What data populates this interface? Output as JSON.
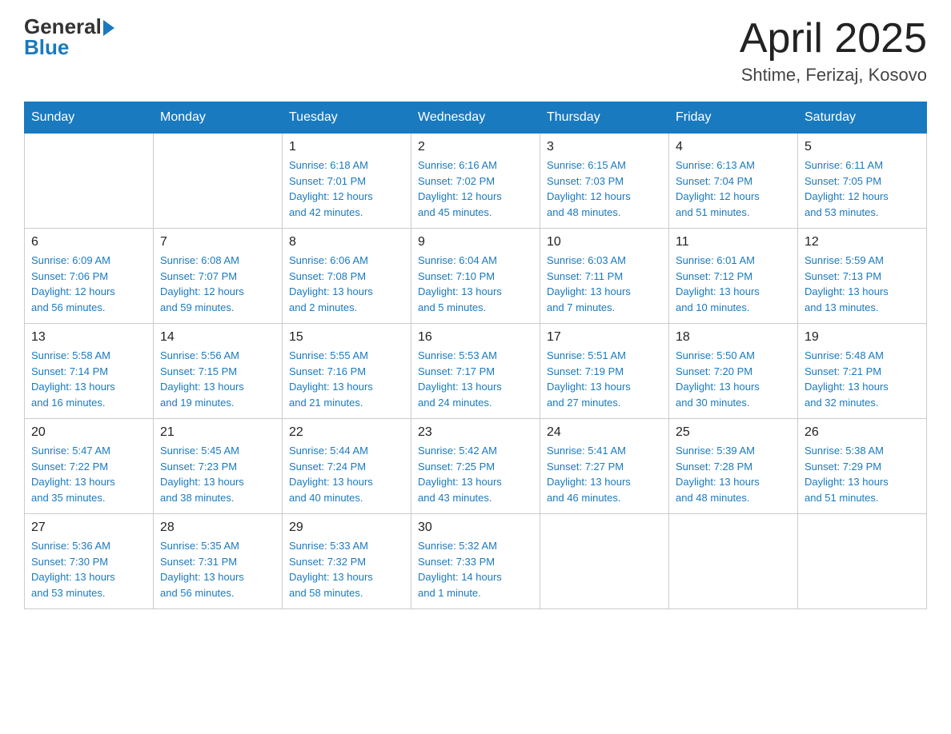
{
  "header": {
    "logo_general": "General",
    "logo_blue": "Blue",
    "title": "April 2025",
    "subtitle": "Shtime, Ferizaj, Kosovo"
  },
  "days_of_week": [
    "Sunday",
    "Monday",
    "Tuesday",
    "Wednesday",
    "Thursday",
    "Friday",
    "Saturday"
  ],
  "weeks": [
    [
      {
        "day": "",
        "info": ""
      },
      {
        "day": "",
        "info": ""
      },
      {
        "day": "1",
        "info": "Sunrise: 6:18 AM\nSunset: 7:01 PM\nDaylight: 12 hours\nand 42 minutes."
      },
      {
        "day": "2",
        "info": "Sunrise: 6:16 AM\nSunset: 7:02 PM\nDaylight: 12 hours\nand 45 minutes."
      },
      {
        "day": "3",
        "info": "Sunrise: 6:15 AM\nSunset: 7:03 PM\nDaylight: 12 hours\nand 48 minutes."
      },
      {
        "day": "4",
        "info": "Sunrise: 6:13 AM\nSunset: 7:04 PM\nDaylight: 12 hours\nand 51 minutes."
      },
      {
        "day": "5",
        "info": "Sunrise: 6:11 AM\nSunset: 7:05 PM\nDaylight: 12 hours\nand 53 minutes."
      }
    ],
    [
      {
        "day": "6",
        "info": "Sunrise: 6:09 AM\nSunset: 7:06 PM\nDaylight: 12 hours\nand 56 minutes."
      },
      {
        "day": "7",
        "info": "Sunrise: 6:08 AM\nSunset: 7:07 PM\nDaylight: 12 hours\nand 59 minutes."
      },
      {
        "day": "8",
        "info": "Sunrise: 6:06 AM\nSunset: 7:08 PM\nDaylight: 13 hours\nand 2 minutes."
      },
      {
        "day": "9",
        "info": "Sunrise: 6:04 AM\nSunset: 7:10 PM\nDaylight: 13 hours\nand 5 minutes."
      },
      {
        "day": "10",
        "info": "Sunrise: 6:03 AM\nSunset: 7:11 PM\nDaylight: 13 hours\nand 7 minutes."
      },
      {
        "day": "11",
        "info": "Sunrise: 6:01 AM\nSunset: 7:12 PM\nDaylight: 13 hours\nand 10 minutes."
      },
      {
        "day": "12",
        "info": "Sunrise: 5:59 AM\nSunset: 7:13 PM\nDaylight: 13 hours\nand 13 minutes."
      }
    ],
    [
      {
        "day": "13",
        "info": "Sunrise: 5:58 AM\nSunset: 7:14 PM\nDaylight: 13 hours\nand 16 minutes."
      },
      {
        "day": "14",
        "info": "Sunrise: 5:56 AM\nSunset: 7:15 PM\nDaylight: 13 hours\nand 19 minutes."
      },
      {
        "day": "15",
        "info": "Sunrise: 5:55 AM\nSunset: 7:16 PM\nDaylight: 13 hours\nand 21 minutes."
      },
      {
        "day": "16",
        "info": "Sunrise: 5:53 AM\nSunset: 7:17 PM\nDaylight: 13 hours\nand 24 minutes."
      },
      {
        "day": "17",
        "info": "Sunrise: 5:51 AM\nSunset: 7:19 PM\nDaylight: 13 hours\nand 27 minutes."
      },
      {
        "day": "18",
        "info": "Sunrise: 5:50 AM\nSunset: 7:20 PM\nDaylight: 13 hours\nand 30 minutes."
      },
      {
        "day": "19",
        "info": "Sunrise: 5:48 AM\nSunset: 7:21 PM\nDaylight: 13 hours\nand 32 minutes."
      }
    ],
    [
      {
        "day": "20",
        "info": "Sunrise: 5:47 AM\nSunset: 7:22 PM\nDaylight: 13 hours\nand 35 minutes."
      },
      {
        "day": "21",
        "info": "Sunrise: 5:45 AM\nSunset: 7:23 PM\nDaylight: 13 hours\nand 38 minutes."
      },
      {
        "day": "22",
        "info": "Sunrise: 5:44 AM\nSunset: 7:24 PM\nDaylight: 13 hours\nand 40 minutes."
      },
      {
        "day": "23",
        "info": "Sunrise: 5:42 AM\nSunset: 7:25 PM\nDaylight: 13 hours\nand 43 minutes."
      },
      {
        "day": "24",
        "info": "Sunrise: 5:41 AM\nSunset: 7:27 PM\nDaylight: 13 hours\nand 46 minutes."
      },
      {
        "day": "25",
        "info": "Sunrise: 5:39 AM\nSunset: 7:28 PM\nDaylight: 13 hours\nand 48 minutes."
      },
      {
        "day": "26",
        "info": "Sunrise: 5:38 AM\nSunset: 7:29 PM\nDaylight: 13 hours\nand 51 minutes."
      }
    ],
    [
      {
        "day": "27",
        "info": "Sunrise: 5:36 AM\nSunset: 7:30 PM\nDaylight: 13 hours\nand 53 minutes."
      },
      {
        "day": "28",
        "info": "Sunrise: 5:35 AM\nSunset: 7:31 PM\nDaylight: 13 hours\nand 56 minutes."
      },
      {
        "day": "29",
        "info": "Sunrise: 5:33 AM\nSunset: 7:32 PM\nDaylight: 13 hours\nand 58 minutes."
      },
      {
        "day": "30",
        "info": "Sunrise: 5:32 AM\nSunset: 7:33 PM\nDaylight: 14 hours\nand 1 minute."
      },
      {
        "day": "",
        "info": ""
      },
      {
        "day": "",
        "info": ""
      },
      {
        "day": "",
        "info": ""
      }
    ]
  ]
}
